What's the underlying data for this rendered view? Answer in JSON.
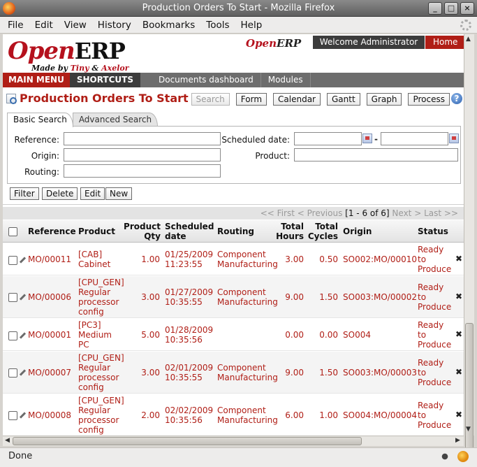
{
  "window": {
    "title": "Production Orders To Start - Mozilla Firefox",
    "btn_min": "_",
    "btn_max": "□",
    "btn_close": "×"
  },
  "menu": [
    "File",
    "Edit",
    "View",
    "History",
    "Bookmarks",
    "Tools",
    "Help"
  ],
  "header": {
    "logo_open": "Open",
    "logo_erp": "ERP",
    "logo_made_by": "Made by",
    "logo_tiny": "Tiny",
    "logo_and": "&",
    "logo_axelor": "Axelor",
    "logo2_open": "Open",
    "logo2_erp": "ERP",
    "welcome": "Welcome Administrator",
    "home": "Home"
  },
  "nav": {
    "main_menu": "MAIN MENU",
    "shortcuts": "SHORTCUTS",
    "links": [
      "Documents dashboard",
      "Modules"
    ]
  },
  "page": {
    "title": "Production Orders To Start",
    "view_buttons": [
      "Search",
      "Form",
      "Calendar",
      "Gantt",
      "Graph",
      "Process"
    ],
    "help": "?"
  },
  "search": {
    "tabs": [
      "Basic Search",
      "Advanced Search"
    ],
    "labels": {
      "reference": "Reference:",
      "origin": "Origin:",
      "routing": "Routing:",
      "scheduled_date": "Scheduled date:",
      "product": "Product:"
    },
    "date_separator": "-"
  },
  "actions": [
    "Filter",
    "Delete",
    "Edit",
    "New"
  ],
  "pager": {
    "first": "<< First",
    "previous": "< Previous",
    "range": "[1 - 6 of 6]",
    "next": "Next >",
    "last": "Last >>"
  },
  "grid": {
    "columns": {
      "reference": "Reference",
      "product": "Product",
      "product_qty_1": "Product",
      "product_qty_2": "Qty",
      "scheduled_1": "Scheduled",
      "scheduled_2": "date",
      "routing": "Routing",
      "total_hours_1": "Total",
      "total_hours_2": "Hours",
      "total_cycles_1": "Total",
      "total_cycles_2": "Cycles",
      "origin": "Origin",
      "status": "Status"
    },
    "rows": [
      {
        "reference": "MO/00011",
        "product": [
          "[CAB]",
          "Cabinet"
        ],
        "qty": "1.00",
        "date": "01/25/2009",
        "time": "11:23:55",
        "routing": [
          "Component",
          "Manufacturing"
        ],
        "hours": "3.00",
        "cycles": "0.50",
        "origin": "SO002:MO/00010",
        "status": [
          "Ready",
          "to",
          "Produce"
        ]
      },
      {
        "reference": "MO/00006",
        "product": [
          "[CPU_GEN]",
          "Regular",
          "processor",
          "config"
        ],
        "qty": "3.00",
        "date": "01/27/2009",
        "time": "10:35:55",
        "routing": [
          "Component",
          "Manufacturing"
        ],
        "hours": "9.00",
        "cycles": "1.50",
        "origin": "SO003:MO/00002",
        "status": [
          "Ready",
          "to",
          "Produce"
        ]
      },
      {
        "reference": "MO/00001",
        "product": [
          "[PC3]",
          "Medium",
          "PC"
        ],
        "qty": "5.00",
        "date": "01/28/2009",
        "time": "10:35:56",
        "routing": [
          "",
          ""
        ],
        "hours": "0.00",
        "cycles": "0.00",
        "origin": "SO004",
        "status": [
          "Ready",
          "to",
          "Produce"
        ]
      },
      {
        "reference": "MO/00007",
        "product": [
          "[CPU_GEN]",
          "Regular",
          "processor",
          "config"
        ],
        "qty": "3.00",
        "date": "02/01/2009",
        "time": "10:35:55",
        "routing": [
          "Component",
          "Manufacturing"
        ],
        "hours": "9.00",
        "cycles": "1.50",
        "origin": "SO003:MO/00003",
        "status": [
          "Ready",
          "to",
          "Produce"
        ]
      },
      {
        "reference": "MO/00008",
        "product": [
          "[CPU_GEN]",
          "Regular",
          "processor",
          "config"
        ],
        "qty": "2.00",
        "date": "02/02/2009",
        "time": "10:35:56",
        "routing": [
          "Component",
          "Manufacturing"
        ],
        "hours": "6.00",
        "cycles": "1.00",
        "origin": "SO004:MO/00004",
        "status": [
          "Ready",
          "to",
          "Produce"
        ]
      }
    ],
    "delete_glyph": "✖"
  },
  "statusbar": {
    "text": "Done"
  }
}
